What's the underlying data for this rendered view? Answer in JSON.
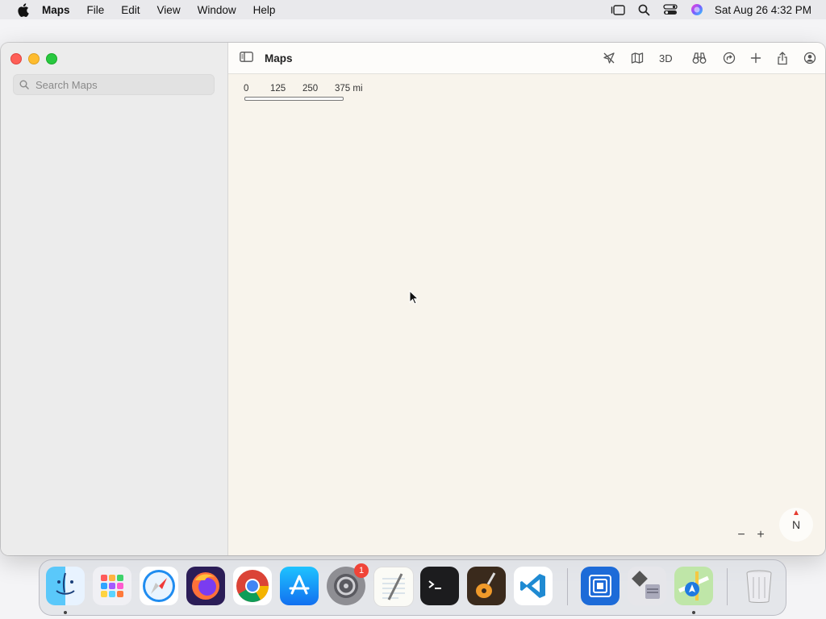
{
  "menubar": {
    "app_name": "Maps",
    "items": [
      "File",
      "Edit",
      "View",
      "Window",
      "Help"
    ],
    "clock": "Sat Aug 26  4:32 PM"
  },
  "window": {
    "title": "Maps",
    "search": {
      "placeholder": "Search Maps",
      "value": ""
    },
    "toolbar": {
      "three_d_label": "3D"
    }
  },
  "map": {
    "scale_labels": [
      "0",
      "125",
      "250",
      "375 mi"
    ],
    "zoom_out_label": "−",
    "zoom_in_label": "+",
    "compass_label": "N"
  },
  "dock": {
    "apps": [
      "Finder",
      "Launchpad",
      "Safari",
      "Firefox",
      "Chrome",
      "App Store",
      "System Settings",
      "TextEdit",
      "Terminal",
      "GarageBand",
      "Visual Studio Code",
      "Remote Desktop",
      "Boot Camp Assistant",
      "Maps",
      "Trash"
    ],
    "settings_badge": "1"
  },
  "colors": {
    "map_background": "#f8f4ec",
    "sidebar_background": "#ececec",
    "accent": "#1f7ae0"
  }
}
